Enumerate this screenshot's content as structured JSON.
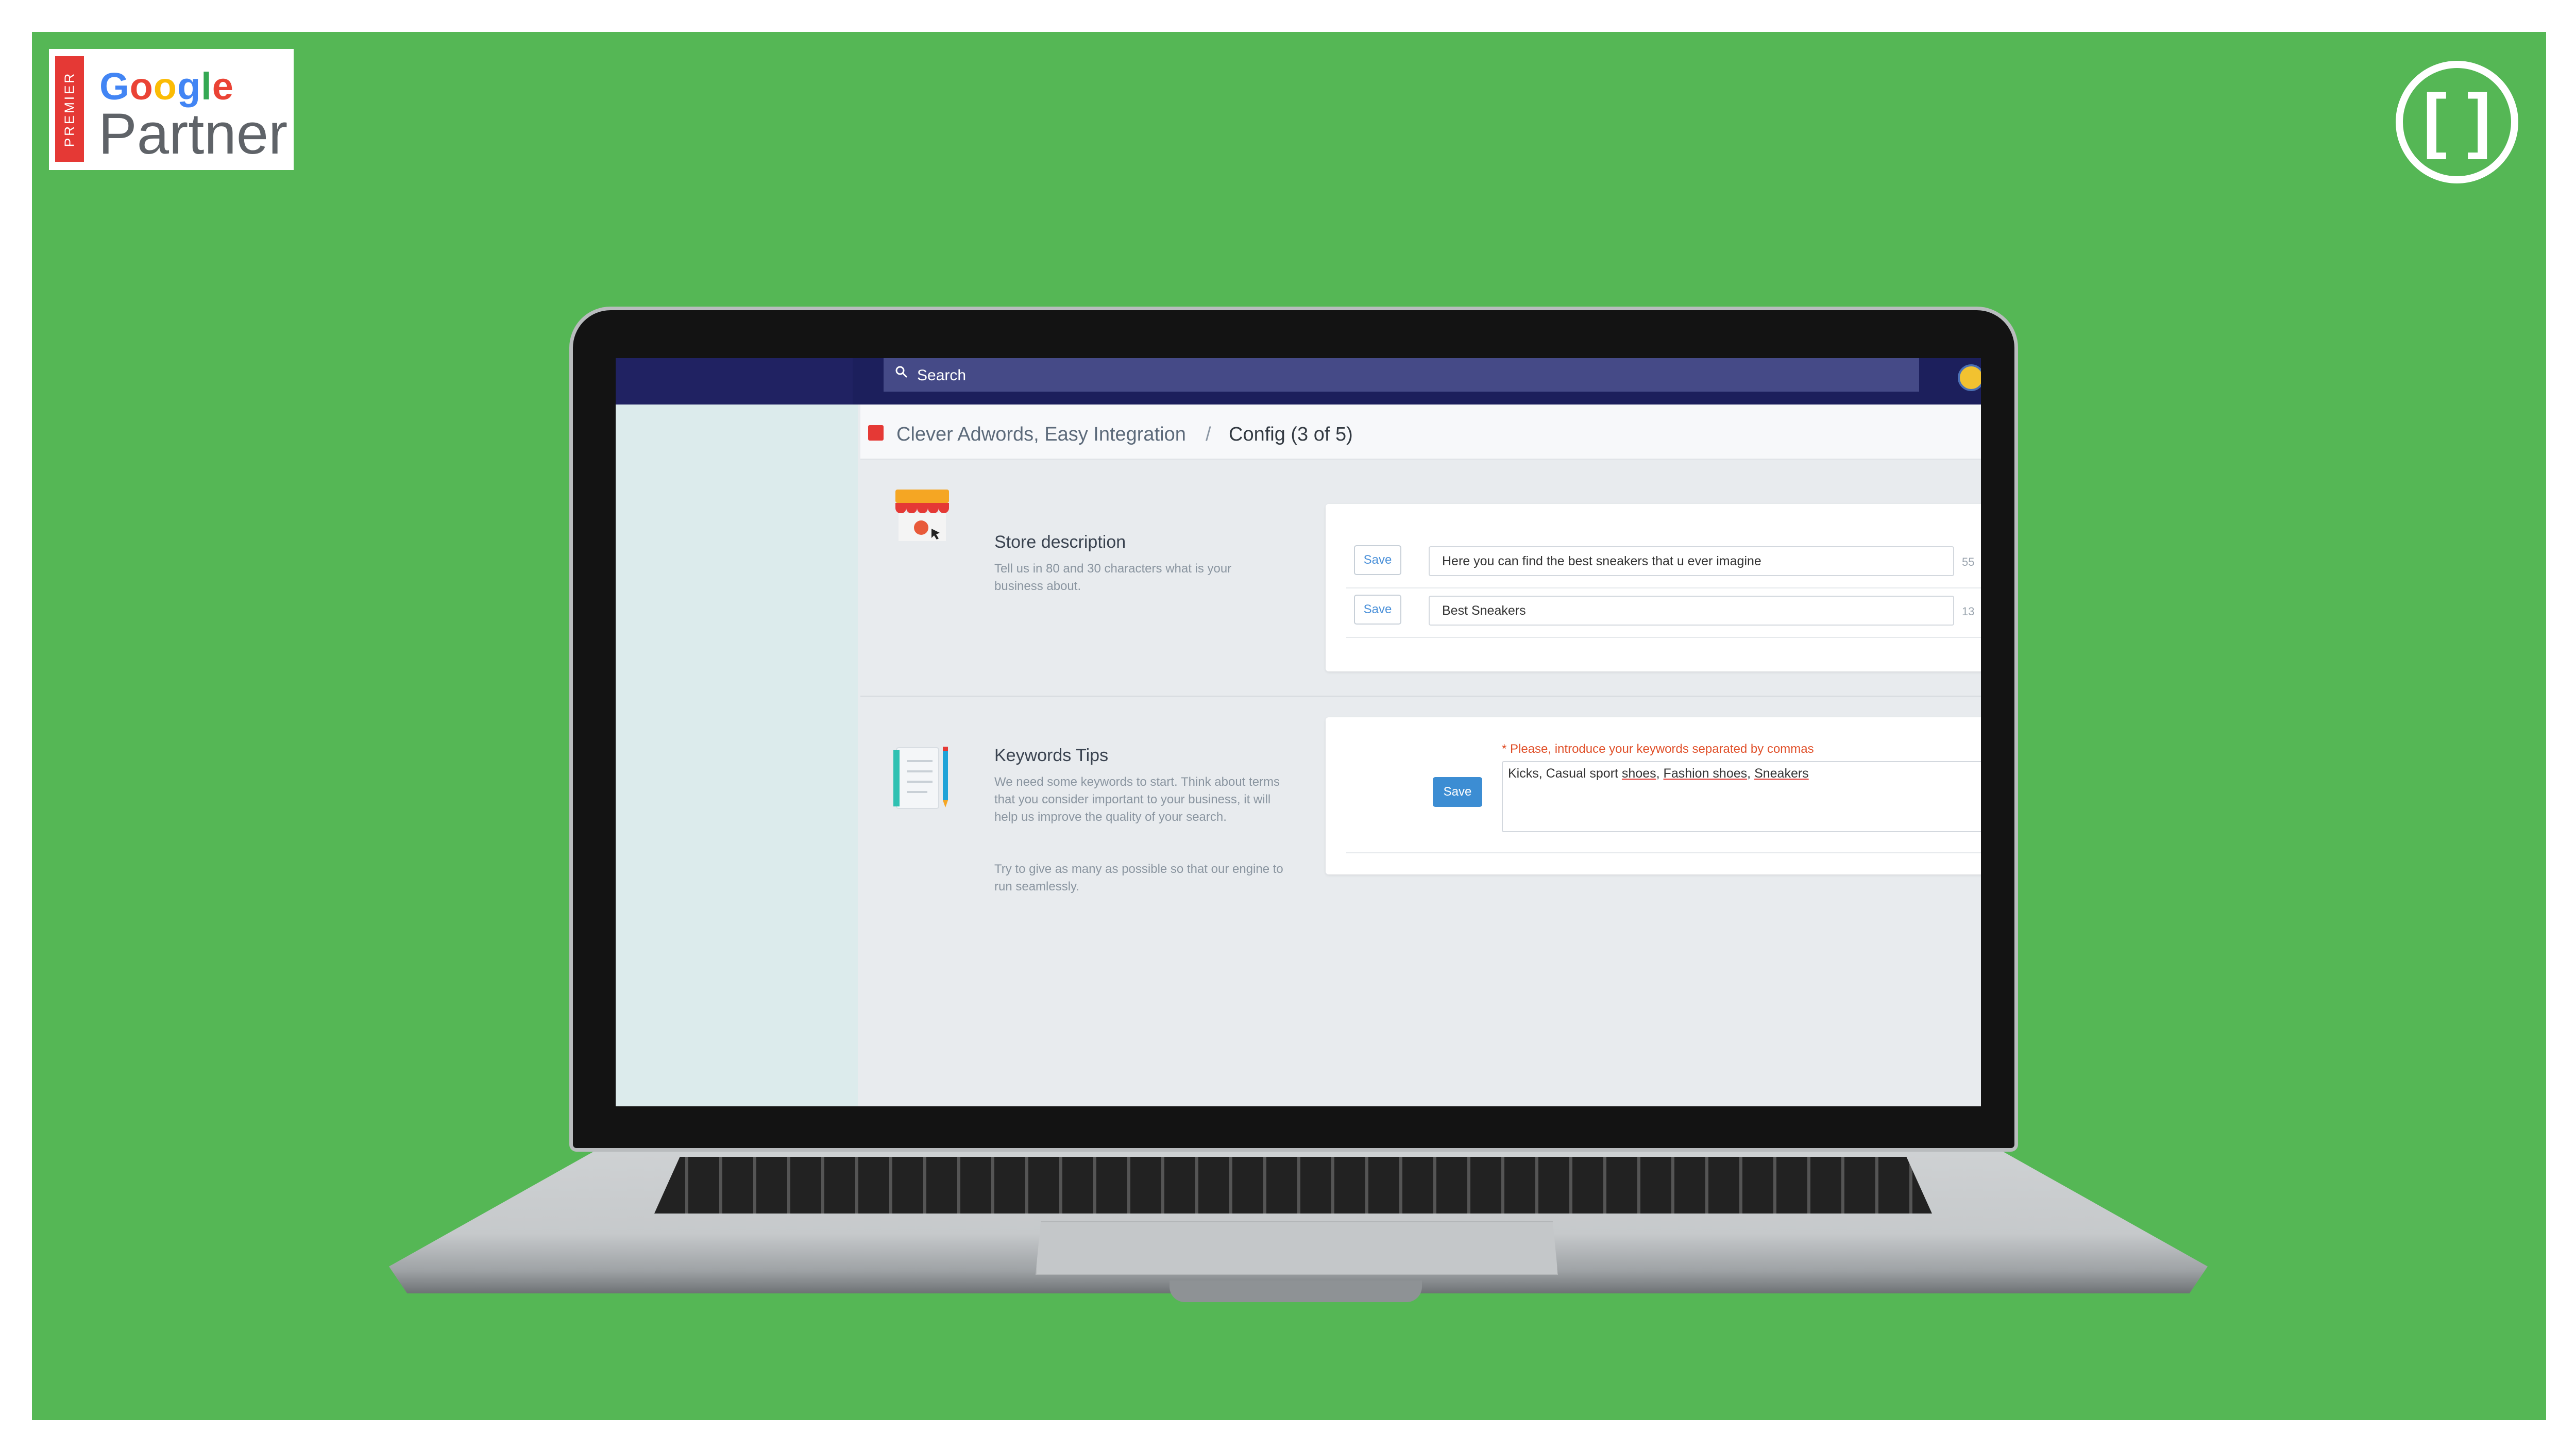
{
  "badge": {
    "strip": "PREMIER",
    "google_letters": [
      {
        "ch": "G",
        "color": "#4285F4"
      },
      {
        "ch": "o",
        "color": "#EA4335"
      },
      {
        "ch": "o",
        "color": "#FBBC05"
      },
      {
        "ch": "g",
        "color": "#4285F4"
      },
      {
        "ch": "l",
        "color": "#34A853"
      },
      {
        "ch": "e",
        "color": "#EA4335"
      }
    ],
    "partner": "Partner"
  },
  "brand_logo": "[ ]",
  "app": {
    "search": {
      "label": "Search",
      "icon": "search-icon"
    },
    "breadcrumb": {
      "app_name": "Clever Adwords, Easy Integration",
      "separator": "/",
      "page": "Config (3 of 5)"
    },
    "store_description": {
      "title": "Store description",
      "description": "Tell us in 80 and 30 characters what is your business about.",
      "rows": [
        {
          "button": "Save",
          "value": "Here you can find the best sneakers that u ever imagine",
          "count": "55"
        },
        {
          "button": "Save",
          "value": "Best Sneakers",
          "count": "13"
        }
      ]
    },
    "keywords": {
      "title": "Keywords Tips",
      "description_1": "We need some keywords to start. Think about terms that you consider important to your business, it will help us improve the quality of your search.",
      "description_2": "Try to give as many as possible so that our engine to run seamlessly.",
      "button": "Save",
      "hint": "* Please, introduce your keywords separated by commas",
      "value_parts": [
        "Kicks, Casual sport ",
        "shoes",
        ", ",
        "Fashion shoes",
        ", ",
        "Sneakers"
      ]
    }
  },
  "colors": {
    "background": "#55b755",
    "topbar": "#1c1f5c",
    "search_bar": "#454a87",
    "primary_button": "#3c8dd3",
    "hint": "#e0502a"
  }
}
